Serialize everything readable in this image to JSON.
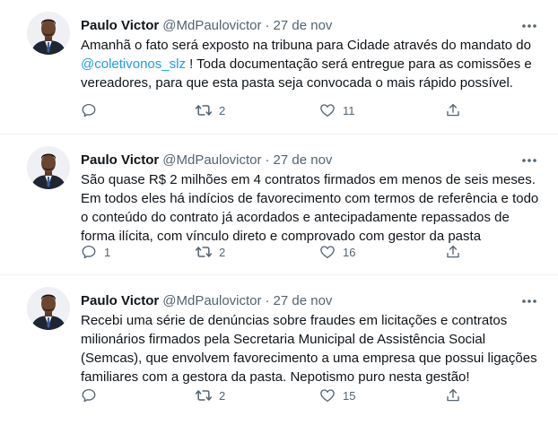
{
  "colors": {
    "text": "#0f1419",
    "secondary": "#536471",
    "link": "#1d9bf0",
    "divider": "#eff3f4"
  },
  "icons": {
    "more": "more-horizontal-icon",
    "reply": "reply-bubble-icon",
    "retweet": "retweet-arrows-icon",
    "like": "heart-icon",
    "share": "share-upload-icon"
  },
  "tweets": [
    {
      "author": "Paulo Victor",
      "handle": "@MdPaulovictor",
      "separator": "·",
      "date": "27 de nov",
      "text_before": "Amanhã o fato será exposto na tribuna para Cidade através do mandato do ",
      "mention": "@coletivonos_slz",
      "text_after": " ! Toda documentação será entregue para as comissões e vereadores, para que esta pasta seja convocada o mais rápido possível.",
      "replies": "",
      "retweets": "2",
      "likes": "11"
    },
    {
      "author": "Paulo Victor",
      "handle": "@MdPaulovictor",
      "separator": "·",
      "date": "27 de nov",
      "text": "São quase R$ 2 milhões em 4 contratos firmados em menos de seis meses. Em todos eles há indícios de favorecimento com termos de referência e todo o conteúdo do contrato já acordados e antecipadamente repassados de forma ilícita, com vínculo direto e comprovado com gestor da pasta",
      "replies": "1",
      "retweets": "2",
      "likes": "16"
    },
    {
      "author": "Paulo Victor",
      "handle": "@MdPaulovictor",
      "separator": "·",
      "date": "27 de nov",
      "text": "Recebi uma série de denúncias sobre fraudes em licitações e contratos milionários firmados pela Secretaria Municipal de Assistência Social (Semcas), que envolvem favorecimento a uma empresa que possui ligações familiares com a gestora da pasta. Nepotismo puro nesta gestão!",
      "replies": "",
      "retweets": "2",
      "likes": "15"
    }
  ]
}
